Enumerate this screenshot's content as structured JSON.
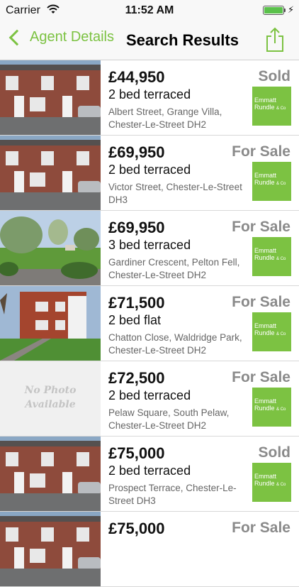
{
  "status_bar": {
    "carrier": "Carrier",
    "time": "11:52 AM"
  },
  "nav": {
    "back_label": "Agent Details",
    "title": "Search Results"
  },
  "colors": {
    "accent": "#7cc242",
    "status_text": "#8a8a8a"
  },
  "listings": [
    {
      "price": "£44,950",
      "beds": "2 bed terraced",
      "address": "Albert Street, Grange Villa, Chester-Le-Street DH2",
      "status": "Sold",
      "agent_line1": "Emmatt",
      "agent_line2": "Rundle",
      "agent_suffix": "& Co",
      "photo": "terraced-street-photo"
    },
    {
      "price": "£69,950",
      "beds": "2 bed terraced",
      "address": "Victor Street, Chester-Le-Street DH3",
      "status": "For Sale",
      "agent_line1": "Emmatt",
      "agent_line2": "Rundle",
      "agent_suffix": "& Co",
      "photo": "terraced-street-photo"
    },
    {
      "price": "£69,950",
      "beds": "3 bed terraced",
      "address": "Gardiner Crescent, Pelton Fell, Chester-Le-Street DH2",
      "status": "For Sale",
      "agent_line1": "Emmatt",
      "agent_line2": "Rundle",
      "agent_suffix": "& Co",
      "photo": "green-trees-photo"
    },
    {
      "price": "£71,500",
      "beds": "2 bed flat",
      "address": "Chatton Close, Waldridge Park, Chester-Le-Street DH2",
      "status": "For Sale",
      "agent_line1": "Emmatt",
      "agent_line2": "Rundle",
      "agent_suffix": "& Co",
      "photo": "brick-flats-photo"
    },
    {
      "price": "£72,500",
      "beds": "2 bed terraced",
      "address": "Pelaw Square, South Pelaw, Chester-Le-Street DH2",
      "status": "For Sale",
      "agent_line1": "Emmatt",
      "agent_line2": "Rundle",
      "agent_suffix": "& Co",
      "photo": "no-photo",
      "nophoto_line1": "No Photo",
      "nophoto_line2": "Available"
    },
    {
      "price": "£75,000",
      "beds": "2 bed terraced",
      "address": "Prospect Terrace, Chester-Le-Street DH3",
      "status": "Sold",
      "agent_line1": "Emmatt",
      "agent_line2": "Rundle",
      "agent_suffix": "& Co",
      "photo": "terraced-street-photo"
    },
    {
      "price": "£75,000",
      "beds": "",
      "address": "",
      "status": "For Sale",
      "agent_line1": "",
      "agent_line2": "",
      "agent_suffix": "",
      "photo": "terraced-street-photo"
    }
  ]
}
